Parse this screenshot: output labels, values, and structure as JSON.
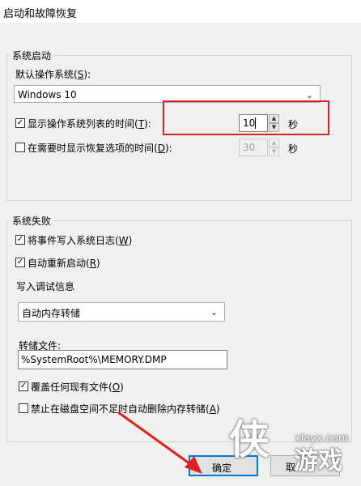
{
  "window": {
    "title": "启动和故障恢复"
  },
  "system_startup": {
    "legend": "系统启动",
    "default_os_label": "默认操作系统(",
    "default_os_key": "S",
    "default_os_tail": "):",
    "default_os_value": "Windows 10",
    "show_list_label": "显示操作系统列表的时间(",
    "show_list_key": "T",
    "show_list_tail": "):",
    "show_list_value": "10",
    "show_list_unit": "秒",
    "show_recovery_label": "在需要时显示恢复选项的时间(",
    "show_recovery_key": "D",
    "show_recovery_tail": "):",
    "show_recovery_value": "30",
    "show_recovery_unit": "秒"
  },
  "system_failure": {
    "legend": "系统失败",
    "write_event_label": "将事件写入系统日志(",
    "write_event_key": "W",
    "write_event_tail": ")",
    "auto_restart_label": "自动重新启动(",
    "auto_restart_key": "R",
    "auto_restart_tail": ")",
    "debug_info": {
      "legend": "写入调试信息",
      "dump_type": "自动内存转储",
      "dump_file_label": "转储文件:",
      "dump_file_value": "%SystemRoot%\\MEMORY.DMP",
      "overwrite_label": "覆盖任何现有文件(",
      "overwrite_key": "O",
      "overwrite_tail": ")",
      "disable_autodelete_label": "禁止在磁盘空间不足时自动删除内存转储(",
      "disable_autodelete_key": "A",
      "disable_autodelete_tail": ")"
    }
  },
  "buttons": {
    "ok": "确定",
    "cancel": "取"
  },
  "watermark": {
    "logo": "侠",
    "site": "xiayx.com",
    "name": "游戏"
  },
  "colors": {
    "highlight": "#e02020",
    "arrow": "#e02020"
  },
  "icons": {
    "checkbox_checked": "check-icon",
    "dropdown": "chevron-down-icon",
    "spin_up": "spin-up-icon",
    "spin_down": "spin-down-icon"
  }
}
